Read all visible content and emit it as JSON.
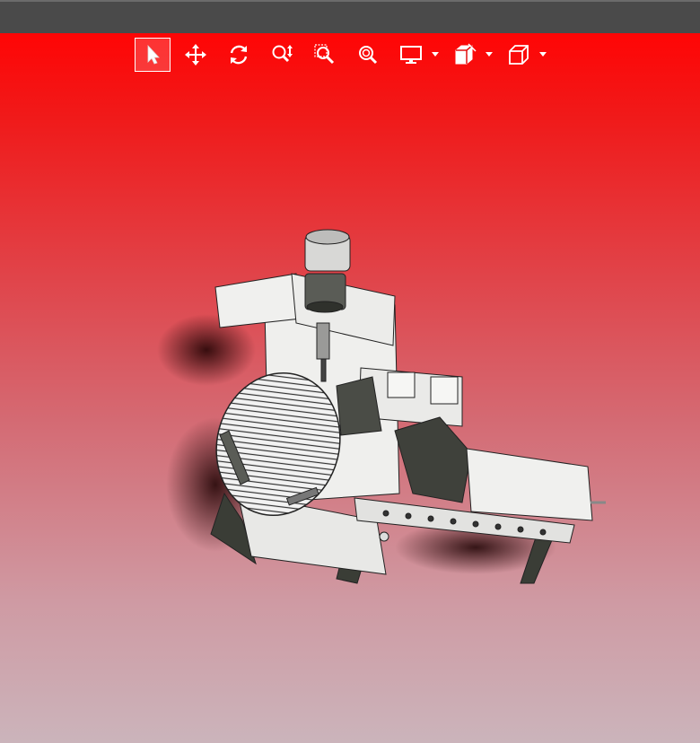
{
  "toolbar": {
    "tools": [
      {
        "name": "select-tool",
        "icon": "cursor-arrow-icon",
        "active": true
      },
      {
        "name": "pan-tool",
        "icon": "four-way-arrows-icon",
        "active": false
      },
      {
        "name": "rotate-tool",
        "icon": "rotate-arrows-icon",
        "active": false
      },
      {
        "name": "zoom-tool",
        "icon": "zoom-vertical-icon",
        "active": false
      },
      {
        "name": "zoom-window-tool",
        "icon": "zoom-window-icon",
        "active": false
      },
      {
        "name": "zoom-fit-tool",
        "icon": "zoom-fit-icon",
        "active": false
      },
      {
        "name": "display-style-menu",
        "icon": "monitor-icon",
        "has_dropdown": true
      },
      {
        "name": "section-view-menu",
        "icon": "section-box-icon",
        "has_dropdown": true
      },
      {
        "name": "view-orientation-menu",
        "icon": "cube-icon",
        "has_dropdown": true
      }
    ]
  },
  "colors": {
    "titlebar": "#4a4a4a",
    "viewport_top": "#ff0505",
    "viewport_bottom": "#cbb4bb",
    "icon": "#ffffff"
  },
  "viewport": {
    "model_icon": "cnc-machine-3d-model"
  }
}
